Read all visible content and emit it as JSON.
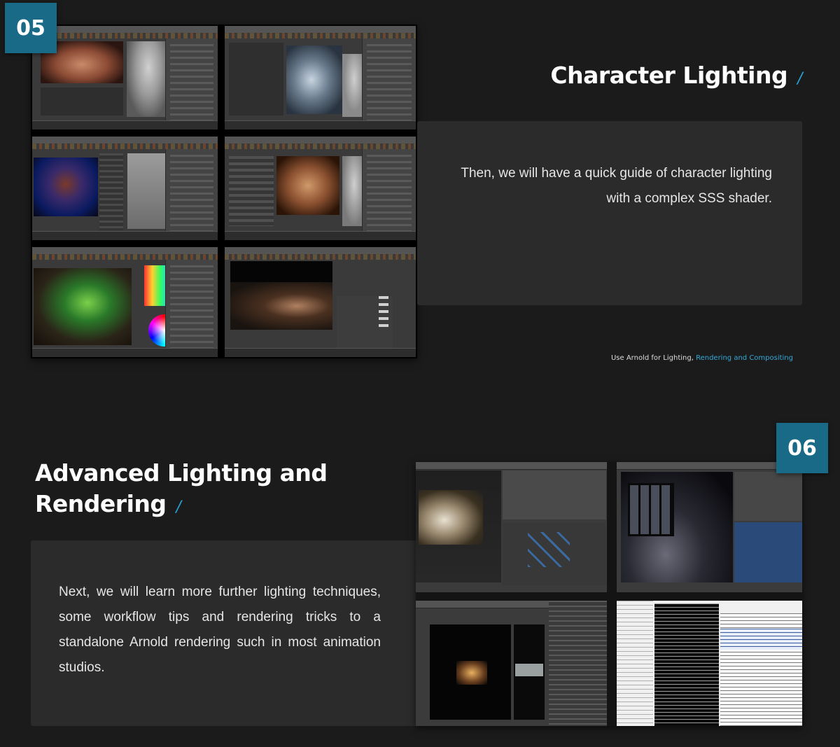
{
  "section5": {
    "badge": "05",
    "title": "Character Lighting",
    "description_line1": "Then, we will have a quick guide of character lighting",
    "description_line2": "with a complex SSS shader.",
    "credit_prefix": "Use Arnold for Lighting, ",
    "credit_link": "Rendering and Compositing"
  },
  "section6": {
    "badge": "06",
    "title_line1": "Advanced Lighting and",
    "title_line2": "Rendering",
    "description_lines": [
      "Next, we will learn more further lighting techniques,",
      "some workflow tips and rendering tricks to a",
      "standalone Arnold rendering such in most animation",
      "studios."
    ]
  },
  "colors": {
    "background": "#1b1b1b",
    "panel": "#2b2b2b",
    "badge": "#186a86",
    "accent": "#2a9fd0"
  }
}
